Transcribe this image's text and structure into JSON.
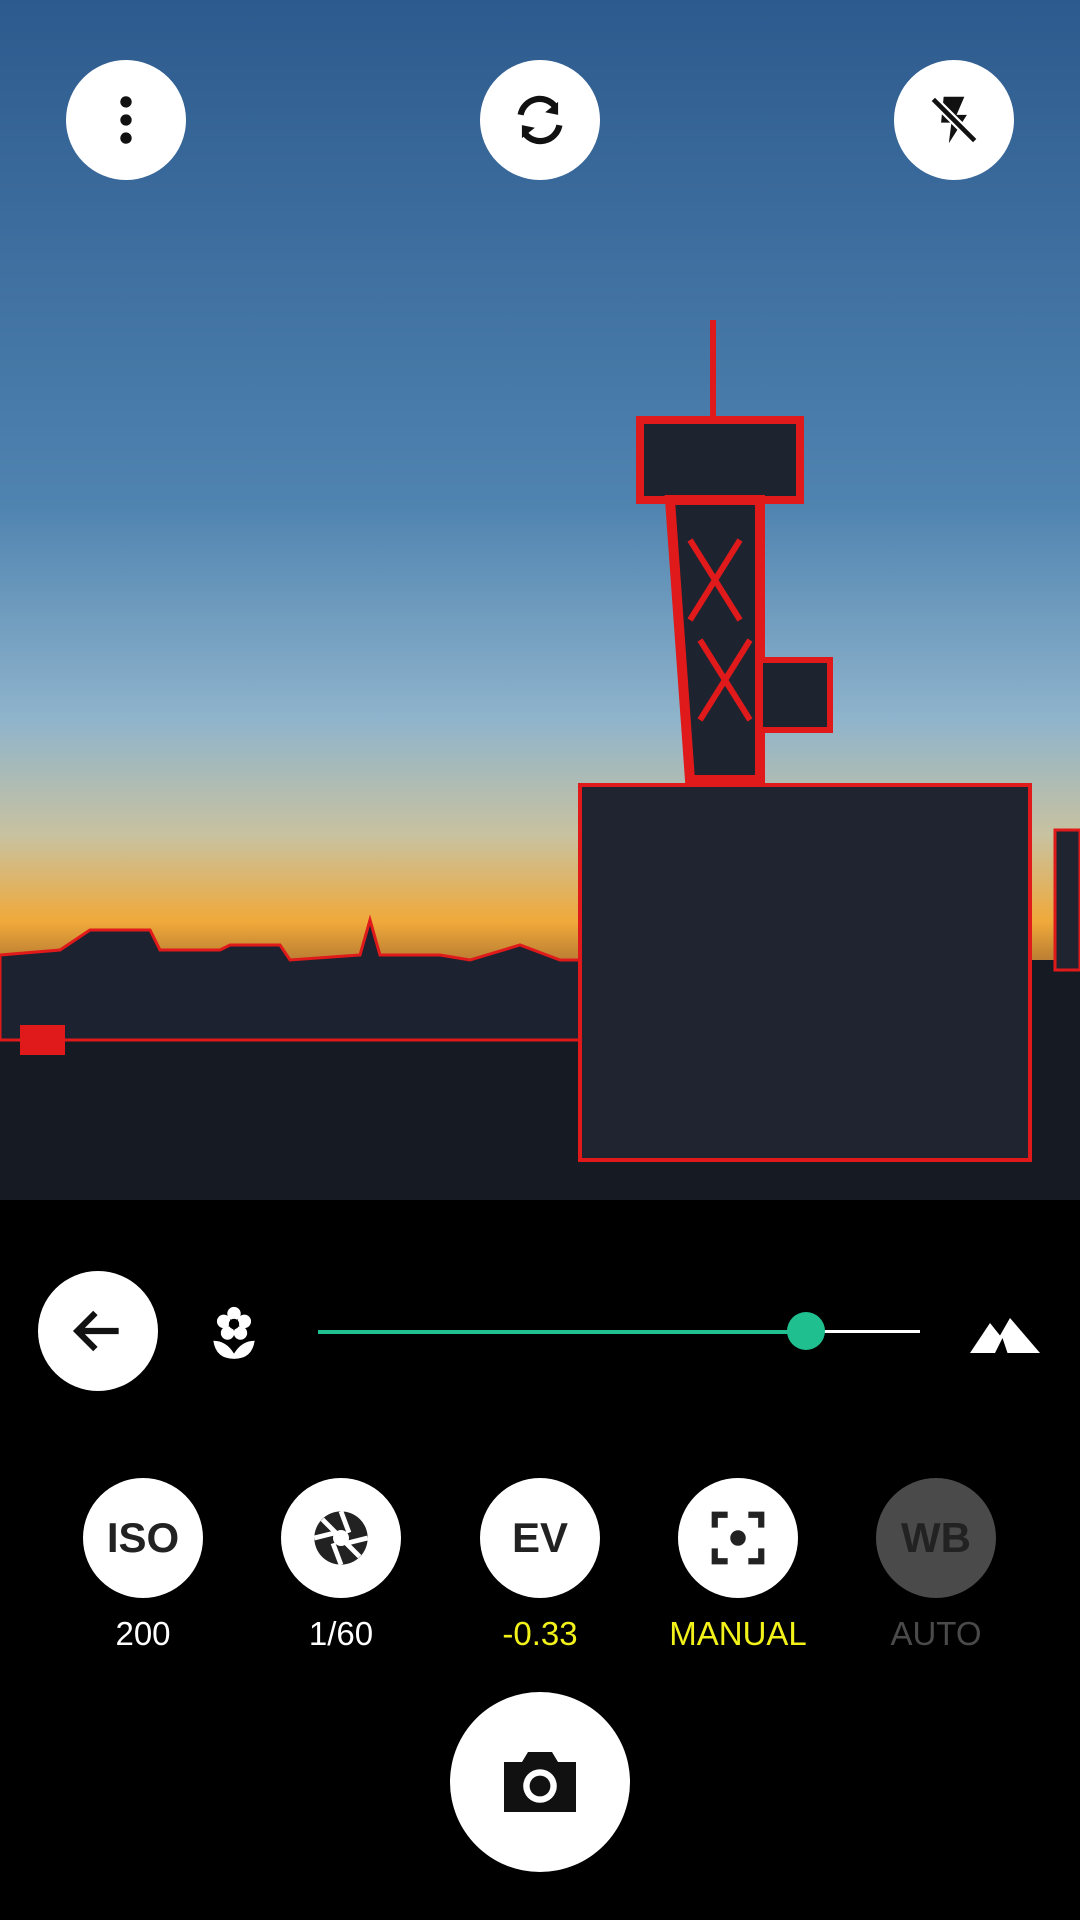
{
  "top_bar": {
    "menu_icon": "more-vert-icon",
    "switch_camera_icon": "switch-camera-icon",
    "flash_icon": "flash-off-icon"
  },
  "focus": {
    "back_icon": "arrow-left-icon",
    "near_icon": "flower-macro-icon",
    "far_icon": "mountain-landscape-icon",
    "slider_value": 0.81,
    "accent_color": "#1fbf8f"
  },
  "settings": [
    {
      "label": "ISO",
      "value": "200",
      "value_color": "#ffffff",
      "enabled": true
    },
    {
      "label": "",
      "icon": "aperture-shutter-icon",
      "value": "1/60",
      "value_color": "#ffffff",
      "enabled": true
    },
    {
      "label": "EV",
      "value": "-0.33",
      "value_color": "#f2f21a",
      "enabled": true
    },
    {
      "label": "",
      "icon": "focus-mode-icon",
      "value": "MANUAL",
      "value_color": "#f2f21a",
      "enabled": true
    },
    {
      "label": "WB",
      "value": "AUTO",
      "value_color": "#4a4a4a",
      "enabled": false
    }
  ],
  "shutter": {
    "icon": "camera-icon"
  }
}
